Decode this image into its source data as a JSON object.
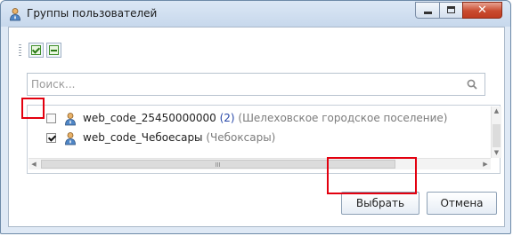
{
  "window": {
    "title": "Группы пользователей",
    "close_glyph": "✕",
    "accent_color": "#e3000f"
  },
  "toolbar": {
    "check_all_icon": "check-all-icon",
    "uncheck_all_icon": "uncheck-all-icon"
  },
  "search": {
    "placeholder": "Поиск...",
    "value": ""
  },
  "groups": {
    "items": [
      {
        "checked": false,
        "name": "web_code_25450000000",
        "count": "(2)",
        "description": "(Шелеховское городское поселение)"
      },
      {
        "checked": true,
        "name": "web_code_Чебоесары",
        "count": "",
        "description": "(Чебоксары)"
      }
    ]
  },
  "footer": {
    "select_label": "Выбрать",
    "cancel_label": "Отмена"
  }
}
